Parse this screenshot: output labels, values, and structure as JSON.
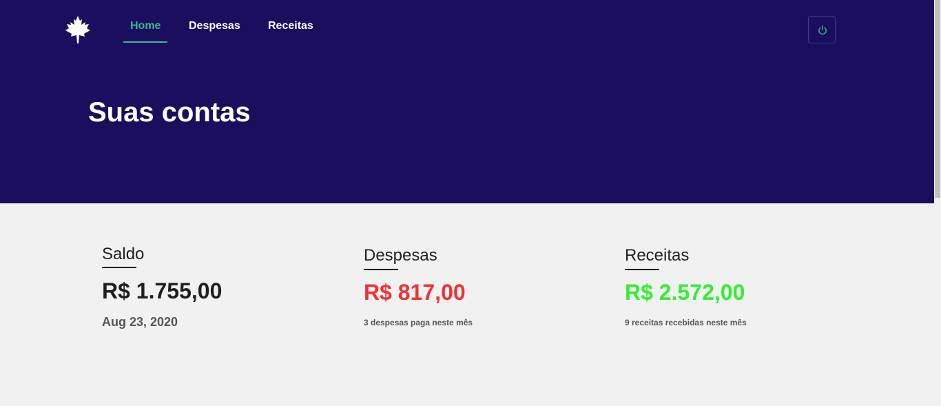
{
  "navbar": {
    "logo": "maple-leaf-icon",
    "items": [
      {
        "label": "Home",
        "active": true
      },
      {
        "label": "Despesas",
        "active": false
      },
      {
        "label": "Receitas",
        "active": false
      }
    ],
    "power_icon": "power-icon"
  },
  "hero": {
    "title": "Suas contas"
  },
  "summary": {
    "saldo": {
      "title": "Saldo",
      "value": "R$ 1.755,00",
      "subtitle": "Aug 23, 2020"
    },
    "despesas": {
      "title": "Despesas",
      "value": "R$ 817,00",
      "subtitle": "3 despesas paga neste mês"
    },
    "receitas": {
      "title": "Receitas",
      "value": "R$ 2.572,00",
      "subtitle": "9 receitas recebidas neste mês"
    }
  },
  "colors": {
    "header_bg": "#1c0e5e",
    "accent": "#2fbf8f",
    "expense": "#f03232",
    "income": "#33ee33",
    "page_bg": "#f1f1f1"
  }
}
